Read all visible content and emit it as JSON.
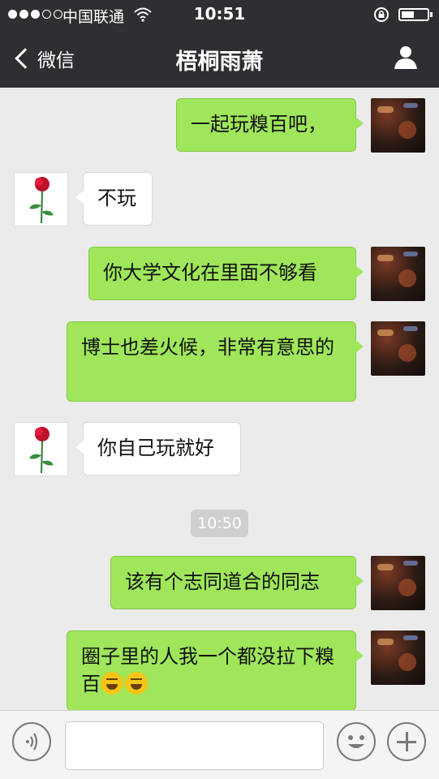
{
  "status_bar": {
    "carrier": "中国联通",
    "time": "10:51"
  },
  "nav": {
    "back_label": "微信",
    "title": "梧桐雨萧"
  },
  "chat": {
    "timestamp": "10:50",
    "messages": [
      {
        "from": "me",
        "text": "一起玩糗百吧，"
      },
      {
        "from": "other",
        "text": "不玩"
      },
      {
        "from": "me",
        "text": "你大学文化在里面不够看"
      },
      {
        "from": "me",
        "text": "博士也差火候，非常有意思的"
      },
      {
        "from": "other",
        "text": "你自己玩就好"
      },
      {
        "from": "me",
        "text": "该有个志同道合的同志"
      },
      {
        "from": "me",
        "text": "圈子里的人我一个都没拉下糗百",
        "emoji": [
          "joy-face",
          "crying-laughing-face"
        ]
      }
    ]
  },
  "input": {
    "value": ""
  },
  "icons": {
    "back": "chevron-left-icon",
    "profile": "person-icon",
    "voice": "voice-icon",
    "emoji": "smile-icon",
    "more": "plus-icon"
  },
  "colors": {
    "topbar": "#2e2f33",
    "chat_bg": "#ebebeb",
    "my_bubble": "#9fe65a",
    "other_bubble": "#ffffff"
  }
}
